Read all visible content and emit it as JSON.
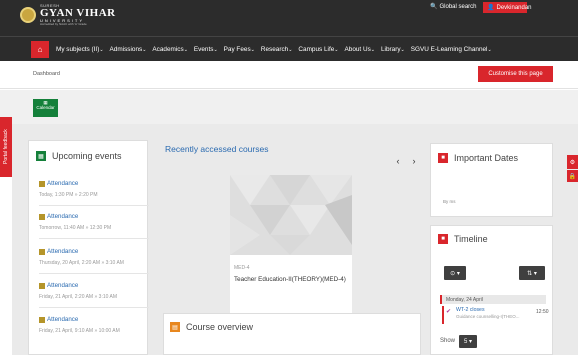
{
  "header": {
    "logo": {
      "small": "SURESH",
      "big": "GYAN VIHAR",
      "uni": "UNIVERSITY",
      "tag": "Accredited by NAAC with 'A' Grade"
    },
    "global_search": "Global search",
    "user_name": "Devkinandan"
  },
  "nav": {
    "items": [
      {
        "label": "My subjects (II)",
        "caret": "⌄"
      },
      {
        "label": "Admissions",
        "caret": "⌄"
      },
      {
        "label": "Academics",
        "caret": "⌄"
      },
      {
        "label": "Events",
        "caret": "⌄"
      },
      {
        "label": "Pay Fees",
        "caret": "⌄"
      },
      {
        "label": "Research",
        "caret": "⌄"
      },
      {
        "label": "Campus Life",
        "caret": "⌄"
      },
      {
        "label": "About Us",
        "caret": "⌄"
      },
      {
        "label": "Library",
        "caret": "⌄"
      },
      {
        "label": "SGVU E-Learning Channel",
        "caret": "⌄"
      }
    ]
  },
  "page": {
    "breadcrumb": "Dashboard",
    "customise_label": "Customise this page",
    "calendar_label": "Calendar",
    "feedback_label": "Portal feedback"
  },
  "upcoming": {
    "title": "Upcoming events",
    "events": [
      {
        "name": "Attendance",
        "time": "Today, 1:30 PM » 2:20 PM"
      },
      {
        "name": "Attendance",
        "time": "Tomorrow, 11:40 AM » 12:30 PM"
      },
      {
        "name": "Attendance",
        "time": "Thursday, 20 April, 2:20 AM » 3:10 AM"
      },
      {
        "name": "Attendance",
        "time": "Friday, 21 April, 2:20 AM » 3:10 AM"
      },
      {
        "name": "Attendance",
        "time": "Friday, 21 April, 9:10 AM » 10:00 AM"
      }
    ]
  },
  "recent": {
    "title": "Recently accessed courses",
    "prev": "‹",
    "next": "›",
    "course": {
      "category": "MED-4",
      "name": "Teacher Education-II(THEORY)(MED-4)"
    }
  },
  "overview": {
    "title": "Course overview"
  },
  "important": {
    "title": "Important Dates",
    "meta": "By ms"
  },
  "timeline": {
    "title": "Timeline",
    "filter_label": "⊙ ▾",
    "sort_label": "⇅ ▾",
    "day": "Monday, 24 April",
    "item_name": "WT-2 closes",
    "item_desc": "Guidance counselling-I(THEO...",
    "item_time": "12:50",
    "show_label": "Show",
    "show_value": "5 ▾"
  },
  "colors": {
    "brand_red": "#d9262c",
    "dark_header": "#2c2c2c",
    "calendar_green": "#14803a",
    "link_blue": "#2a6ab0"
  }
}
